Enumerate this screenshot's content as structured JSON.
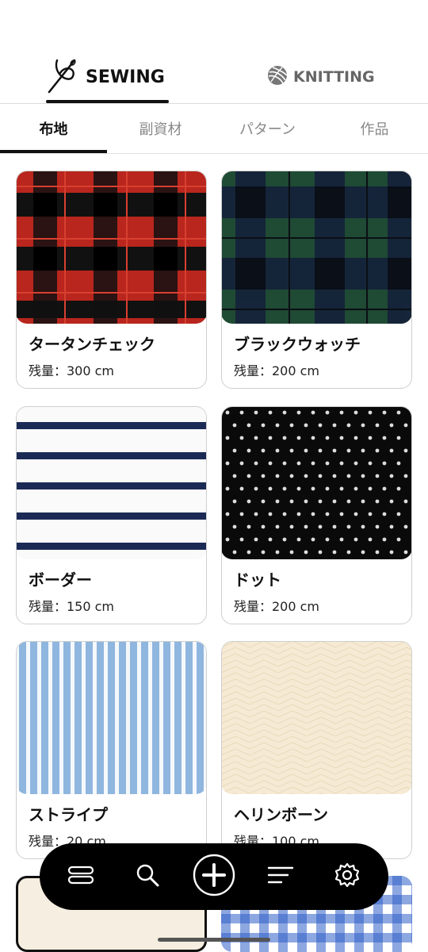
{
  "modes": [
    {
      "label": "SEWING",
      "icon": "needle-thread-icon",
      "active": true
    },
    {
      "label": "KNITTING",
      "icon": "yarn-ball-icon",
      "active": false
    }
  ],
  "categories": [
    {
      "label": "布地",
      "active": true
    },
    {
      "label": "副資材",
      "active": false
    },
    {
      "label": "パターン",
      "active": false
    },
    {
      "label": "作品",
      "active": false
    }
  ],
  "fabrics": [
    {
      "name": "タータンチェック",
      "remaining": "残量：300 cm",
      "pattern": "tartan-red"
    },
    {
      "name": "ブラックウォッチ",
      "remaining": "残量：200 cm",
      "pattern": "black-watch"
    },
    {
      "name": "ボーダー",
      "remaining": "残量：150 cm",
      "pattern": "navy-border"
    },
    {
      "name": "ドット",
      "remaining": "残量：200 cm",
      "pattern": "polka-dot"
    },
    {
      "name": "ストライプ",
      "remaining": "残量：20 cm",
      "pattern": "blue-stripe"
    },
    {
      "name": "ヘリンボーン",
      "remaining": "残量：100 cm",
      "pattern": "herringbone"
    }
  ],
  "bottom_nav": [
    {
      "icon": "menu-icon"
    },
    {
      "icon": "search-icon"
    },
    {
      "icon": "add-icon"
    },
    {
      "icon": "sort-icon"
    },
    {
      "icon": "gear-icon"
    }
  ],
  "colors": {
    "tartan_red": "#b8261d",
    "black_watch_green": "#1f4a34",
    "navy": "#1b2a55",
    "stripe_blue": "#8fb6de",
    "herringbone_cream": "#f6ead4",
    "gingham_blue": "#2f5fc8"
  }
}
